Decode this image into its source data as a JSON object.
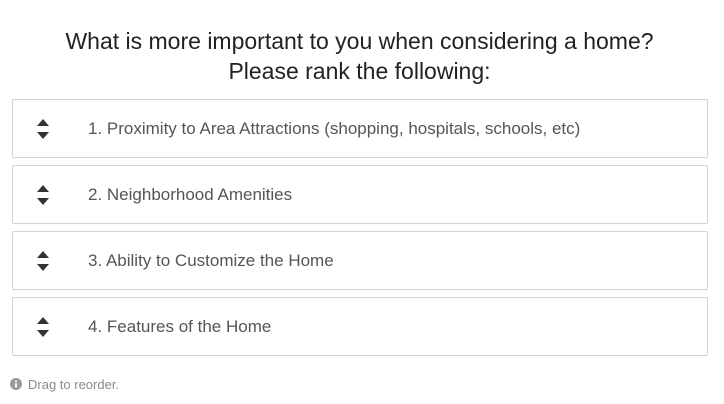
{
  "question": {
    "line1": "What is more important to you when considering a home?",
    "line2": "Please rank the following:"
  },
  "items": [
    {
      "label": "1. Proximity to Area Attractions (shopping, hospitals, schools, etc)",
      "icon": "drag-handle-icon"
    },
    {
      "label": "2. Neighborhood Amenities",
      "icon": "drag-handle-icon"
    },
    {
      "label": "3. Ability to Customize the Home",
      "icon": "drag-handle-icon"
    },
    {
      "label": "4. Features of the Home",
      "icon": "drag-handle-icon"
    }
  ],
  "hint": {
    "icon": "info-icon",
    "text": "Drag to reorder."
  },
  "colors": {
    "border": "#d4d4d4",
    "text": "#555555",
    "hint": "#8a8a8a"
  }
}
